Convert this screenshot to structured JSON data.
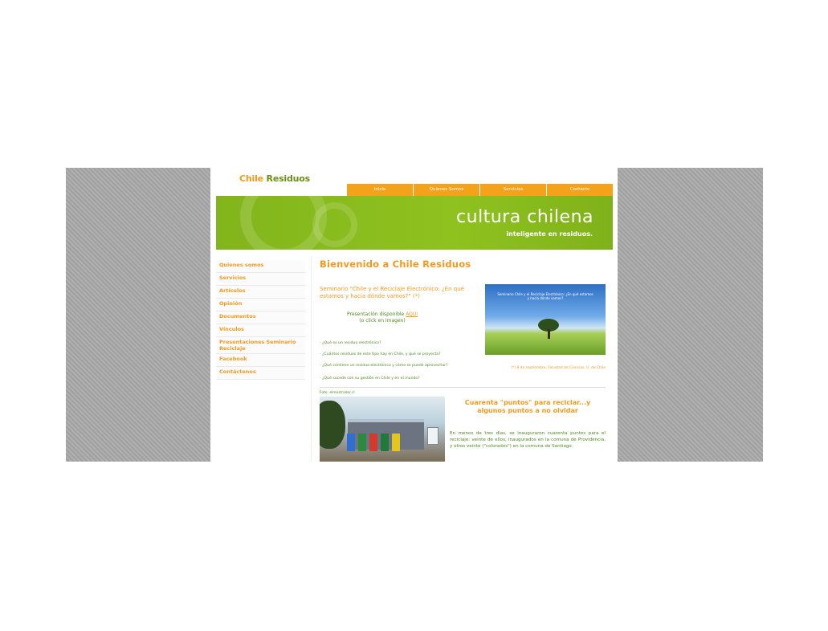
{
  "site": {
    "logo_part1": "Chile",
    "logo_part2": "Residuos",
    "nav": [
      "Inicio",
      "Quienes Somos",
      "Servicios",
      "Contacto"
    ],
    "banner_title": "cultura chilena",
    "banner_subtitle": "inteligente en residuos."
  },
  "sidebar": {
    "items": [
      "Quienes somos",
      "Servicios",
      "Artículos",
      "Opinión",
      "Documentos",
      "Vínculos",
      "Presentaciones Seminario Reciclaje",
      "Facebook",
      "Contáctenos"
    ]
  },
  "main": {
    "title": "Bienvenido a Chile Residuos",
    "seminar_title": "Seminario \"Chile y el Reciclaje Electrónico: ¿En qué estamos y hacia dónde vamos?\" (*)",
    "presentation_line1": "Presentación disponible",
    "presentation_link": "AQUI",
    "presentation_line2": "(o click en imagen)",
    "questions": [
      "- ¿Qué es un residuo electrónico?",
      "- ¿Cuántos residuos de este tipo hay en Chile, y qué se proyecta?",
      "- ¿Qué contiene un residuo electrónico y cómo se puede aprovechar?",
      "- ¿Qué sucede con su gestión en Chile y en el mundo?"
    ],
    "poster_text": "Seminario Chile y el Reciclaje Electrónico: ¿En qué estamos y hacia dónde vamos?",
    "credit": "(*) 8 de septiembre, Facultad de Ciencias, U. de Chile",
    "photo_caption": "Foto: elmostrador.cl",
    "article_title": "Cuarenta \"puntos\" para reciclar...y algunos puntos a no olvidar",
    "article_body": "En menos de tres días, se inauguraron cuarenta puntos para el reciclaje: veinte de ellos, inaugurados en la comuna de Providencia, y otros veinte (\"colorados\") en la comuna de Santiago."
  },
  "colors": {
    "orange": "#f39a1e",
    "green": "#8fc21f",
    "text_green": "#4f8a1f"
  }
}
